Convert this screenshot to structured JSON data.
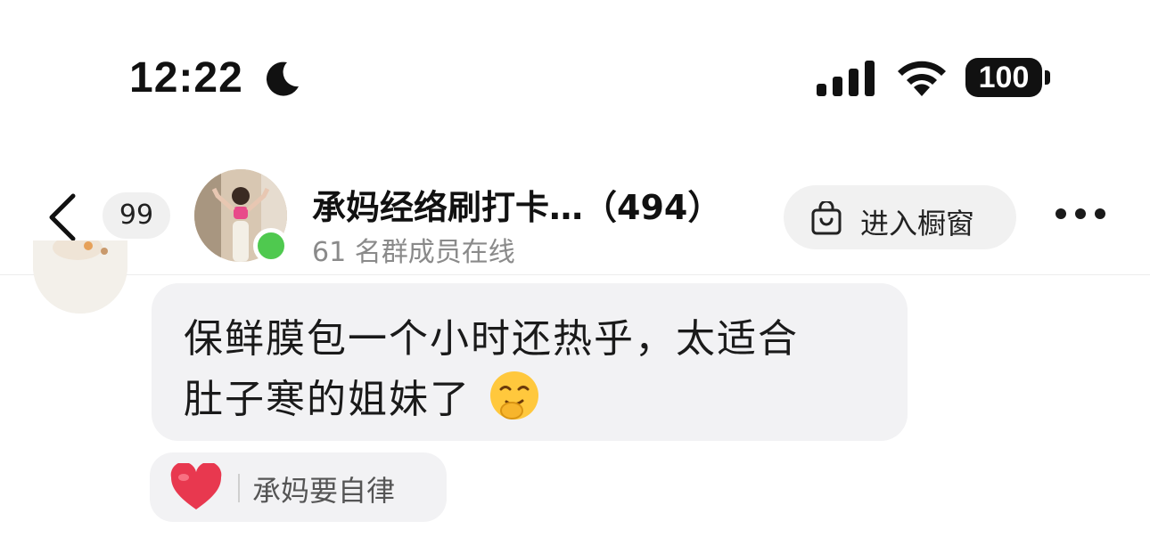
{
  "status_bar": {
    "time": "12:22",
    "battery": "100",
    "icons": [
      "moon-icon",
      "signal-icon",
      "wifi-icon",
      "battery-icon"
    ]
  },
  "header": {
    "back_icon": "chevron-left-icon",
    "unread_count": "99",
    "title": "承妈经络刷打卡…（494）",
    "subtitle": "61 名群成员在线",
    "showcase_label": "进入橱窗",
    "more_icon": "ellipsis-icon"
  },
  "message": {
    "line1": "保鲜膜包一个小时还热乎，太适合",
    "line2": "肚子寒的姐妹了",
    "emoji": "smirk-face-emoji"
  },
  "reaction": {
    "icon": "heart-icon",
    "user": "承妈要自律"
  },
  "colors": {
    "online": "#4fc94f",
    "bubble": "#f2f2f4",
    "heart": "#e8384f"
  }
}
